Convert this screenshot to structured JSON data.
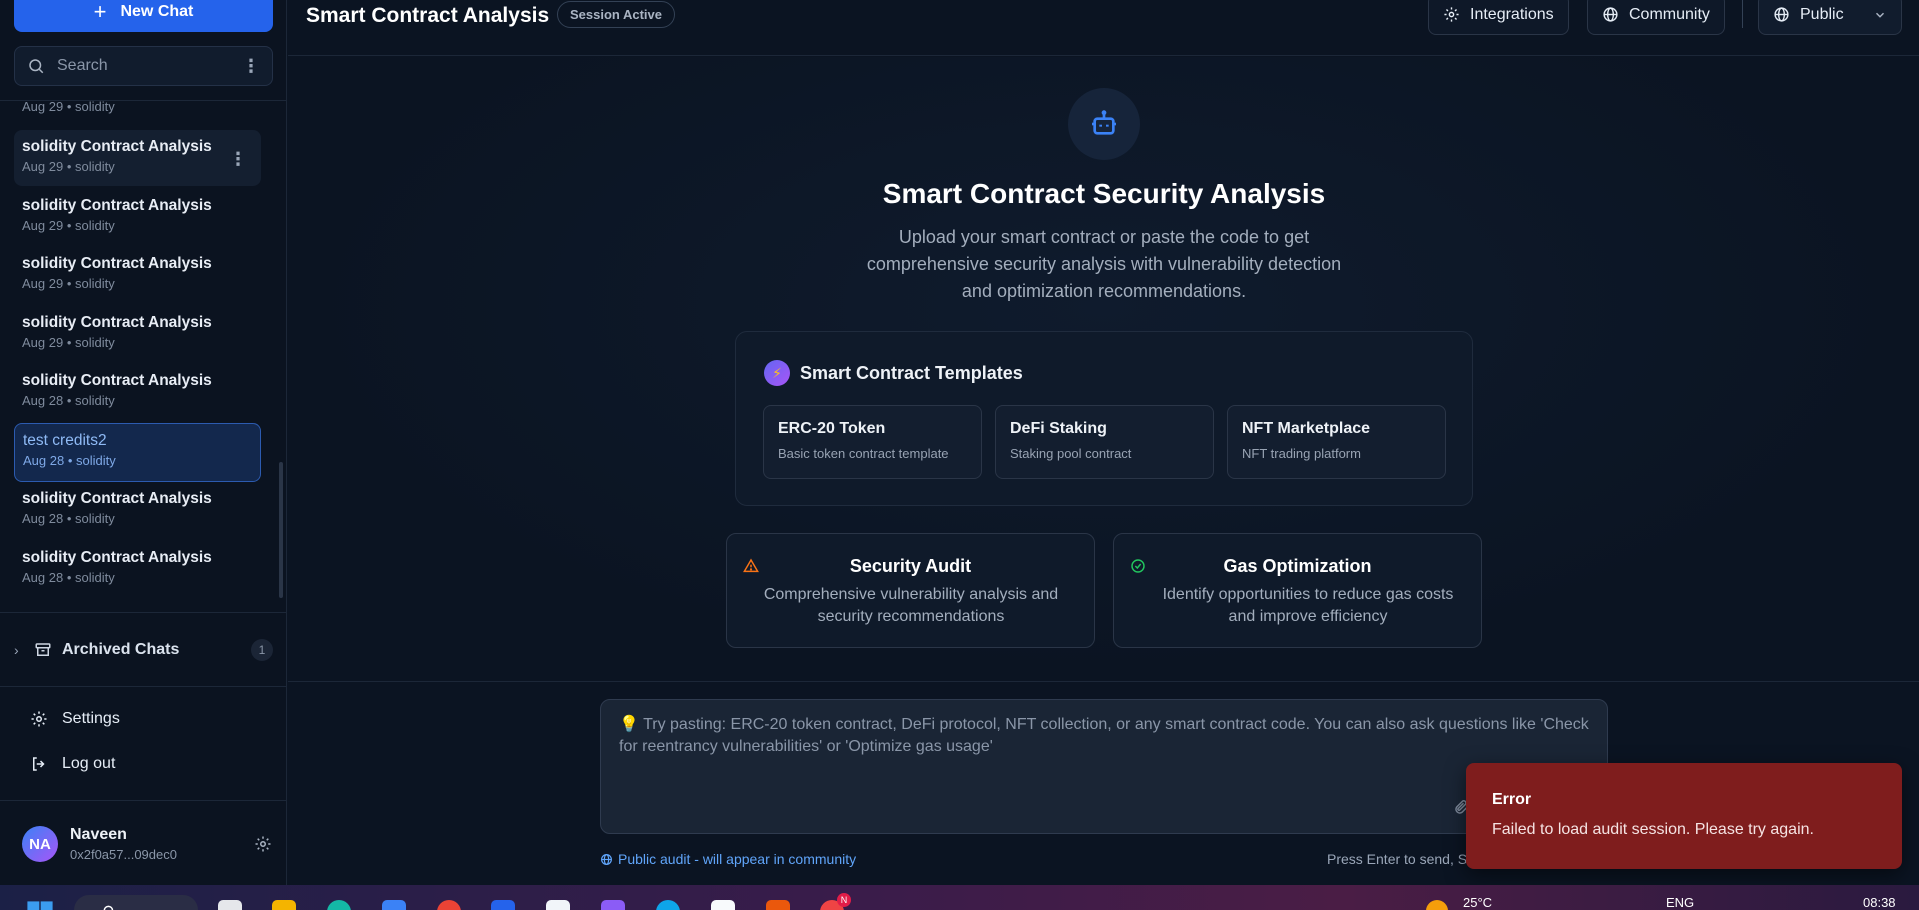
{
  "sidebar": {
    "new_chat_label": "New Chat",
    "search_placeholder": "Search",
    "partial_top_meta": "Aug 29 • solidity",
    "chats": [
      {
        "title": "solidity Contract Analysis",
        "meta": "Aug 29 • solidity"
      },
      {
        "title": "solidity Contract Analysis",
        "meta": "Aug 29 • solidity"
      },
      {
        "title": "solidity Contract Analysis",
        "meta": "Aug 29 • solidity"
      },
      {
        "title": "solidity Contract Analysis",
        "meta": "Aug 29 • solidity"
      },
      {
        "title": "solidity Contract Analysis",
        "meta": "Aug 28 • solidity"
      },
      {
        "title": "test credits2",
        "meta": "Aug 28 • solidity"
      },
      {
        "title": "solidity Contract Analysis",
        "meta": "Aug 28 • solidity"
      },
      {
        "title": "solidity Contract Analysis",
        "meta": "Aug 28 • solidity"
      }
    ],
    "archived_label": "Archived Chats",
    "archived_count": "1",
    "settings_label": "Settings",
    "logout_label": "Log out",
    "user": {
      "initials": "NA",
      "name": "Naveen",
      "address": "0x2f0a57...09dec0"
    }
  },
  "header": {
    "title": "Smart Contract Analysis",
    "session_badge": "Session Active",
    "integrations_label": "Integrations",
    "community_label": "Community",
    "visibility_label": "Public"
  },
  "hero": {
    "title": "Smart Contract Security Analysis",
    "description": "Upload your smart contract or paste the code to get comprehensive security analysis with vulnerability detection and optimization recommendations."
  },
  "templates": {
    "heading": "Smart Contract Templates",
    "items": [
      {
        "title": "ERC-20 Token",
        "desc": "Basic token contract template"
      },
      {
        "title": "DeFi Staking",
        "desc": "Staking pool contract"
      },
      {
        "title": "NFT Marketplace",
        "desc": "NFT trading platform"
      }
    ]
  },
  "features": [
    {
      "title": "Security Audit",
      "desc": "Comprehensive vulnerability analysis and security recommendations"
    },
    {
      "title": "Gas Optimization",
      "desc": "Identify opportunities to reduce gas costs and improve efficiency"
    }
  ],
  "composer": {
    "placeholder": "💡 Try pasting: ERC-20 token contract, DeFi protocol, NFT collection, or any smart contract code. You can also ask questions like 'Check for reentrancy vulnerabilities' or 'Optimize gas usage'",
    "public_note": "Public audit - will appear in community",
    "enter_hint": "Press Enter to send, S"
  },
  "toast": {
    "title": "Error",
    "message": "Failed to load audit session. Please try again."
  },
  "taskbar": {
    "temperature": "25°C",
    "language": "ENG",
    "time": "08:38",
    "notification_badge": "N"
  },
  "colors": {
    "accent": "#2563eb",
    "background": "#0b1422",
    "error": "#7f1d1d",
    "warning": "#f97316",
    "success": "#22c55e"
  }
}
